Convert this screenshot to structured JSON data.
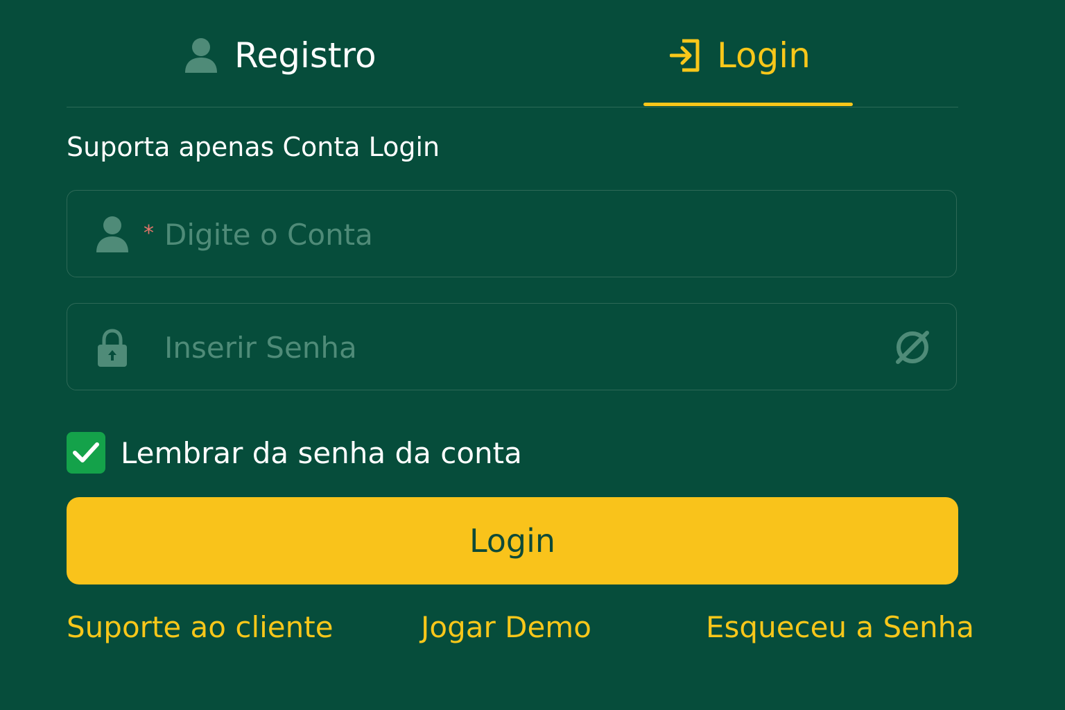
{
  "tabs": {
    "register_label": "Registro",
    "login_label": "Login",
    "active": "login"
  },
  "form": {
    "subtitle": "Suporta apenas Conta Login",
    "account": {
      "required_mark": "*",
      "placeholder": "Digite o Conta",
      "value": ""
    },
    "password": {
      "placeholder": "Inserir Senha",
      "value": ""
    },
    "remember": {
      "label": "Lembrar da senha da conta",
      "checked": true
    },
    "submit_label": "Login"
  },
  "footer": {
    "support_label": "Suporte ao cliente",
    "demo_label": "Jogar Demo",
    "forgot_label": "Esqueceu a Senha"
  },
  "icons": {
    "register_tab": "user-icon",
    "login_tab": "login-arrow-icon",
    "account_field": "user-icon",
    "password_field": "lock-icon",
    "password_toggle": "eye-off-icon",
    "remember": "checkmark-icon"
  },
  "colors": {
    "background": "#064d3b",
    "accent": "#f8c71a",
    "button": "#f9c31b",
    "checkbox": "#14a24a",
    "placeholder": "#4f8b78",
    "required": "#e4756a"
  }
}
